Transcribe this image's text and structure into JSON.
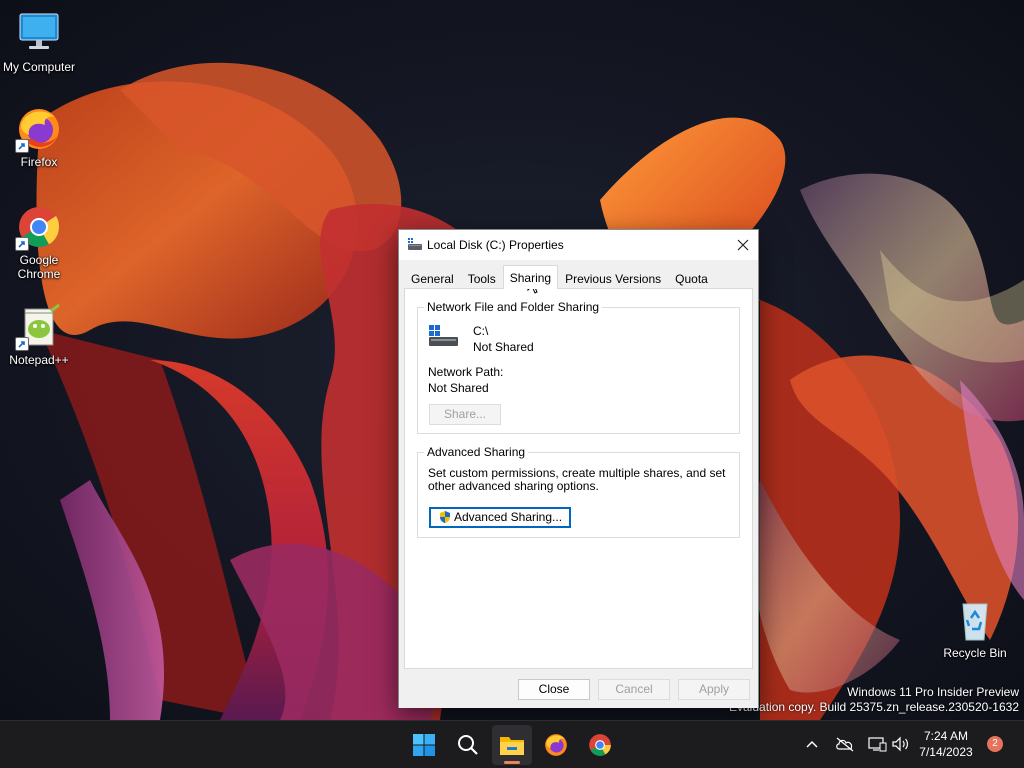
{
  "desktop": {
    "icons": [
      {
        "label": "My Computer",
        "icon": "monitor-icon"
      },
      {
        "label": "Firefox",
        "icon": "firefox-icon"
      },
      {
        "label": "Google Chrome",
        "icon": "chrome-icon"
      },
      {
        "label": "Notepad++",
        "icon": "notepadpp-icon"
      },
      {
        "label": "Recycle Bin",
        "icon": "recycle-bin-icon"
      }
    ],
    "watermark": {
      "line1": "Windows 11 Pro Insider Preview",
      "line2": "Evaluation copy. Build 25375.zn_release.230520-1632"
    }
  },
  "dialog": {
    "title": "Local Disk (C:) Properties",
    "tabs": [
      {
        "label": "General"
      },
      {
        "label": "Tools"
      },
      {
        "label": "Sharing",
        "active": true
      },
      {
        "label": "Previous Versions"
      },
      {
        "label": "Quota"
      }
    ],
    "network_sharing": {
      "legend": "Network File and Folder Sharing",
      "drive_name": "C:\\",
      "drive_status": "Not Shared",
      "path_label": "Network Path:",
      "path_value": "Not Shared",
      "share_button": "Share..."
    },
    "advanced_sharing": {
      "legend": "Advanced Sharing",
      "description": "Set custom permissions, create multiple shares, and set other advanced sharing options.",
      "button": "Advanced Sharing..."
    },
    "buttons": {
      "close": "Close",
      "cancel": "Cancel",
      "apply": "Apply"
    }
  },
  "taskbar": {
    "time": "7:24 AM",
    "date": "7/14/2023",
    "notification_count": "2"
  },
  "colors": {
    "accent": "#0067c0",
    "taskbar": "#1c1c1f",
    "badge": "#e8735c"
  }
}
